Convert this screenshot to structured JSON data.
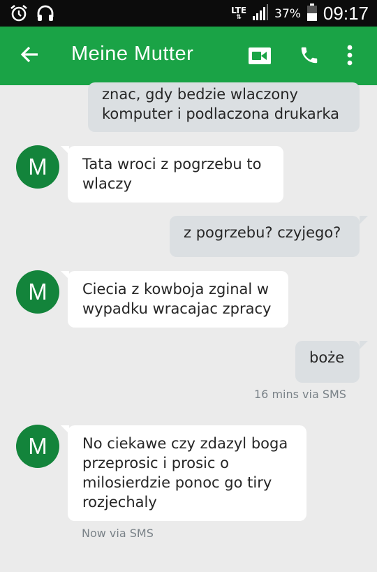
{
  "status_bar": {
    "network": "LTE",
    "battery_percent": "37%",
    "time": "09:17",
    "icons": [
      "alarm-icon",
      "headphones-icon",
      "signal-icon",
      "battery-icon"
    ]
  },
  "header": {
    "title": "Meine Mutter",
    "icons": [
      "back-arrow-icon",
      "video-call-icon",
      "phone-icon",
      "more-vert-icon"
    ],
    "accent_color": "#1aa346"
  },
  "contact": {
    "initial": "M",
    "avatar_color": "#13843b"
  },
  "messages": [
    {
      "direction": "outgoing",
      "lines": [
        "znac, gdy bedzie wlaczony",
        "komputer i podlaczona drukarka"
      ]
    },
    {
      "direction": "incoming",
      "lines": [
        "Tata wroci z pogrzebu to",
        "wlaczy"
      ]
    },
    {
      "direction": "outgoing",
      "lines": [
        "z pogrzebu? czyjego?"
      ]
    },
    {
      "direction": "incoming",
      "lines": [
        "Ciecia z kowboja zginal w",
        "wypadku wracajac zpracy"
      ]
    },
    {
      "direction": "outgoing",
      "lines": [
        "boże"
      ],
      "meta": "16 mins via SMS"
    },
    {
      "direction": "incoming",
      "lines": [
        "No ciekawe czy zdazyl boga",
        "przeprosic i prosic o",
        "milosierdzie ponoc go tiry",
        "rozjechaly"
      ],
      "meta": "Now via SMS"
    }
  ]
}
